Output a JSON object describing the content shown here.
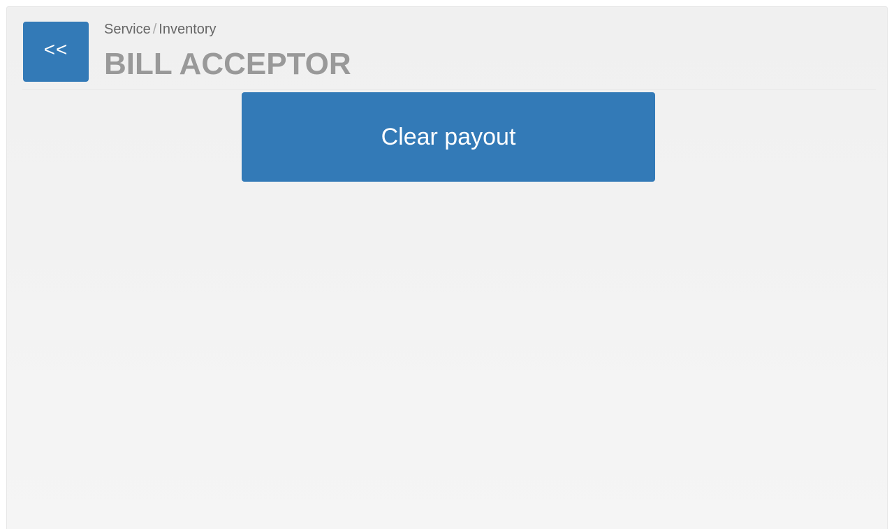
{
  "header": {
    "back_label": "<<",
    "breadcrumb": {
      "parent": "Service",
      "separator": "/",
      "current": "Inventory"
    },
    "title": "BILL ACCEPTOR"
  },
  "actions": {
    "clear_payout_label": "Clear payout"
  },
  "colors": {
    "accent": "#337ab7",
    "title_text": "#999999",
    "background": "#f2f2f2"
  }
}
